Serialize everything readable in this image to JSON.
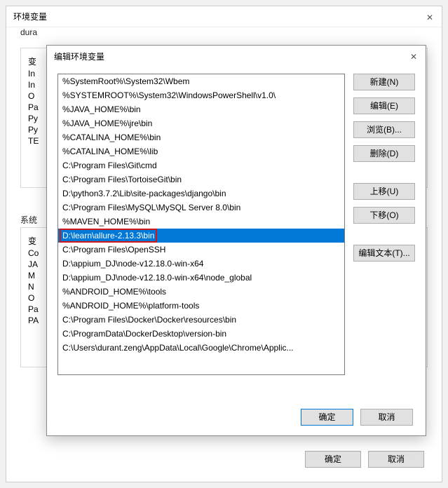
{
  "outer": {
    "title": "环境变量",
    "user_label": "dura",
    "sys_label": "系统",
    "partial_rows1": [
      "变",
      "In",
      "In",
      "O",
      "Pa",
      "Py",
      "Py",
      "TE"
    ],
    "partial_rows2": [
      "变",
      "Co",
      "JA",
      "M",
      "N",
      "O",
      "Pa",
      "PA"
    ],
    "ok": "确定",
    "cancel": "取消"
  },
  "inner": {
    "title": "编辑环境变量",
    "buttons": {
      "new": "新建(N)",
      "edit": "编辑(E)",
      "browse": "浏览(B)...",
      "delete": "删除(D)",
      "move_up": "上移(U)",
      "move_down": "下移(O)",
      "edit_text": "编辑文本(T)..."
    },
    "ok": "确定",
    "cancel": "取消",
    "selected_index": 11,
    "items": [
      "%SystemRoot%\\System32\\Wbem",
      "%SYSTEMROOT%\\System32\\WindowsPowerShell\\v1.0\\",
      "%JAVA_HOME%\\bin",
      "%JAVA_HOME%\\jre\\bin",
      "%CATALINA_HOME%\\bin",
      "%CATALINA_HOME%\\lib",
      "C:\\Program Files\\Git\\cmd",
      "C:\\Program Files\\TortoiseGit\\bin",
      "D:\\python3.7.2\\Lib\\site-packages\\django\\bin",
      "C:\\Program Files\\MySQL\\MySQL Server 8.0\\bin",
      "%MAVEN_HOME%\\bin",
      "D:\\learn\\allure-2.13.3\\bin",
      "C:\\Program Files\\OpenSSH",
      "D:\\appium_DJ\\node-v12.18.0-win-x64",
      "D:\\appium_DJ\\node-v12.18.0-win-x64\\node_global",
      "%ANDROID_HOME%\\tools",
      "%ANDROID_HOME%\\platform-tools",
      "C:\\Program Files\\Docker\\Docker\\resources\\bin",
      "C:\\ProgramData\\DockerDesktop\\version-bin",
      "C:\\Users\\durant.zeng\\AppData\\Local\\Google\\Chrome\\Applic..."
    ]
  }
}
